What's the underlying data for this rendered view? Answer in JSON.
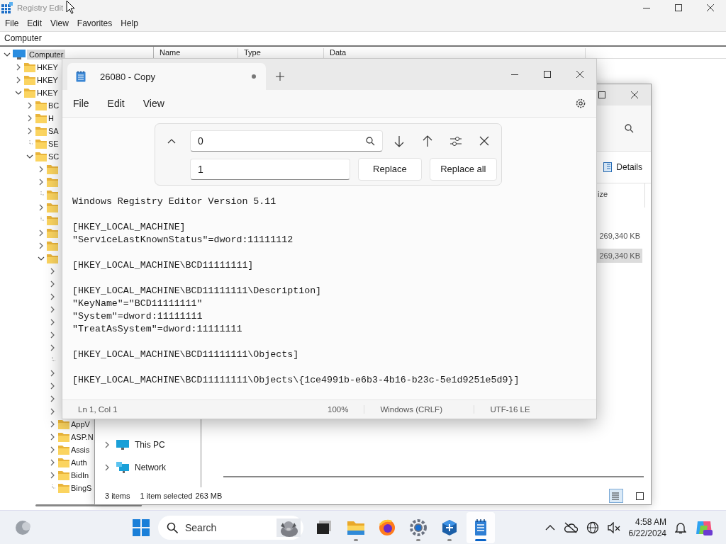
{
  "registry": {
    "title": "Registry Edit",
    "menu": [
      "File",
      "Edit",
      "View",
      "Favorites",
      "Help"
    ],
    "address": "Computer",
    "columns": [
      "Name",
      "Type",
      "Data"
    ],
    "tree": {
      "label": "Computer",
      "selected": true,
      "expanded": true,
      "children": [
        {
          "label": "HKEY",
          "expandable": true,
          "expanded": false,
          "selected": false
        },
        {
          "label": "HKEY",
          "expandable": true,
          "expanded": false,
          "selected": false
        },
        {
          "label": "HKEY",
          "expandable": true,
          "expanded": true,
          "selected": false,
          "children": [
            {
              "label": "BC",
              "expandable": true,
              "expanded": false,
              "selected": false
            },
            {
              "label": "H",
              "expandable": true,
              "expanded": false,
              "selected": false
            },
            {
              "label": "SA",
              "expandable": true,
              "expanded": false,
              "selected": false
            },
            {
              "label": "SE",
              "expandable": false,
              "expanded": false,
              "selected": false
            },
            {
              "label": "SC",
              "expandable": true,
              "expanded": true,
              "selected": false,
              "children": [
                {
                  "expandable": true,
                  "expanded": false
                },
                {
                  "expandable": true,
                  "expanded": false
                },
                {
                  "expandable": false,
                  "expanded": false
                },
                {
                  "expandable": true,
                  "expanded": false
                },
                {
                  "expandable": false,
                  "expanded": false
                },
                {
                  "expandable": true,
                  "expanded": false
                },
                {
                  "expandable": true,
                  "expanded": false
                },
                {
                  "expandable": true,
                  "expanded": true,
                  "children": [
                    {
                      "expandable": true,
                      "expanded": false
                    },
                    {
                      "expandable": true,
                      "expanded": false
                    },
                    {
                      "expandable": true,
                      "expanded": false
                    },
                    {
                      "expandable": true,
                      "expanded": false
                    },
                    {
                      "expandable": true,
                      "expanded": false
                    },
                    {
                      "expandable": true,
                      "expanded": false
                    },
                    {
                      "expandable": true,
                      "expanded": false
                    },
                    {
                      "expandable": false,
                      "expanded": false
                    },
                    {
                      "expandable": true,
                      "expanded": false
                    },
                    {
                      "expandable": true,
                      "expanded": false
                    },
                    {
                      "expandable": true,
                      "expanded": false
                    },
                    {
                      "expandable": true,
                      "expanded": false
                    },
                    {
                      "label": "AppV",
                      "expandable": true,
                      "expanded": false,
                      "selected": false
                    },
                    {
                      "label": "ASP.N",
                      "expandable": true,
                      "expanded": false,
                      "selected": false
                    },
                    {
                      "label": "Assis",
                      "expandable": true,
                      "expanded": false,
                      "selected": false
                    },
                    {
                      "label": "Auth",
                      "expandable": true,
                      "expanded": false,
                      "selected": false
                    },
                    {
                      "label": "BidIn",
                      "expandable": true,
                      "expanded": false,
                      "selected": false
                    },
                    {
                      "label": "BingS",
                      "expandable": false,
                      "expanded": false,
                      "selected": false
                    }
                  ]
                }
              ]
            }
          ]
        }
      ]
    }
  },
  "notepad": {
    "tab_title": "26080 - Copy",
    "unsaved": true,
    "menu": [
      "File",
      "Edit",
      "View"
    ],
    "find_value": "0",
    "replace_value": "1",
    "buttons": [
      "Replace",
      "Replace all"
    ],
    "blocks": [
      [
        "Windows Registry Editor Version 5.11"
      ],
      [
        "[HKEY_LOCAL_MACHINE]",
        "\"ServiceLastKnownStatus\"=dword:11111112"
      ],
      [
        "[HKEY_LOCAL_MACHINE\\BCD11111111]"
      ],
      [
        "[HKEY_LOCAL_MACHINE\\BCD11111111\\Description]",
        "\"KeyName\"=\"BCD11111111\"",
        "\"System\"=dword:11111111",
        "\"TreatAsSystem\"=dword:11111111"
      ],
      [
        "[HKEY_LOCAL_MACHINE\\BCD11111111\\Objects]"
      ],
      [
        "[HKEY_LOCAL_MACHINE\\BCD11111111\\Objects\\{1ce4991b-e6b3-4b16-b23c-5e1d9251e5d9}]"
      ]
    ],
    "status": [
      "Ln 1, Col 1",
      "100%",
      "Windows (CRLF)",
      "UTF-16 LE"
    ]
  },
  "explorer": {
    "view_button": "Details",
    "column": "ize",
    "rows": [
      {
        "size": "269,340 KB",
        "selected": false
      },
      {
        "size": "269,340 KB",
        "selected": true
      }
    ],
    "nav": [
      {
        "label": "This PC",
        "kind": "pc"
      },
      {
        "label": "Network",
        "kind": "network"
      }
    ],
    "status": [
      "3 items",
      "1 item selected",
      "263 MB"
    ],
    "views": [
      {
        "kind": "details",
        "selected": true
      },
      {
        "kind": "tiles",
        "selected": false
      }
    ]
  },
  "taskbar": {
    "search_placeholder": "Search",
    "apps": [
      {
        "kind": "task-view",
        "running": false,
        "active": false
      },
      {
        "kind": "folder",
        "running": true,
        "active": false
      },
      {
        "kind": "browser",
        "running": false,
        "active": false
      },
      {
        "kind": "settings",
        "running": true,
        "active": false
      },
      {
        "kind": "app",
        "running": true,
        "active": false
      },
      {
        "kind": "notepad",
        "running": true,
        "active": true
      }
    ],
    "time": "4:58 AM",
    "date": "6/22/2024"
  }
}
